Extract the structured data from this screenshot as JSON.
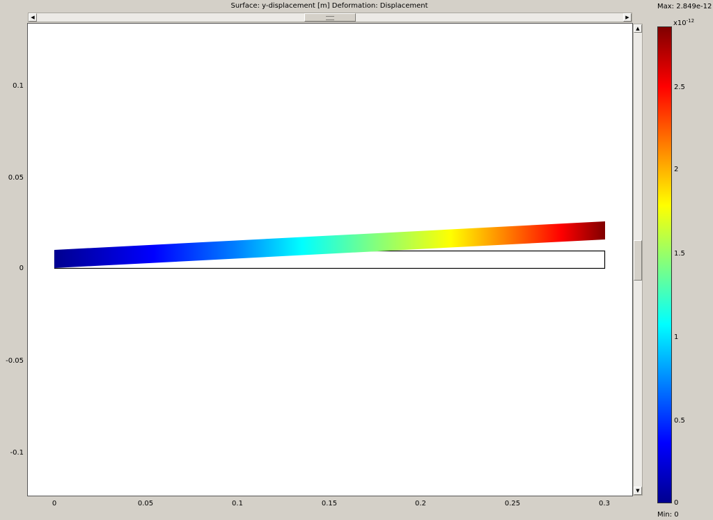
{
  "plot": {
    "title": "Surface: y-displacement [m]   Deformation: Displacement",
    "x_ticks": [
      "0",
      "0.05",
      "0.1",
      "0.15",
      "0.2",
      "0.25",
      "0.3"
    ],
    "y_ticks": [
      "0.1",
      "0.05",
      "0",
      "-0.05",
      "-0.1"
    ]
  },
  "colorbar": {
    "max_label": "Max: 2.849e-12",
    "min_label": "Min: 0",
    "scale_base": "x10",
    "scale_exp": "-12",
    "ticks": [
      "2.5",
      "2",
      "1.5",
      "1",
      "0.5",
      "0"
    ]
  },
  "scrollbars": {
    "left_arrow": "◀",
    "right_arrow": "▶",
    "up_arrow": "▲",
    "down_arrow": "▼"
  },
  "colors": {
    "colormap": [
      "#00008f",
      "#0000ff",
      "#0080ff",
      "#00ffff",
      "#80ff80",
      "#ffff00",
      "#ff8000",
      "#ff0000",
      "#800000"
    ]
  }
}
